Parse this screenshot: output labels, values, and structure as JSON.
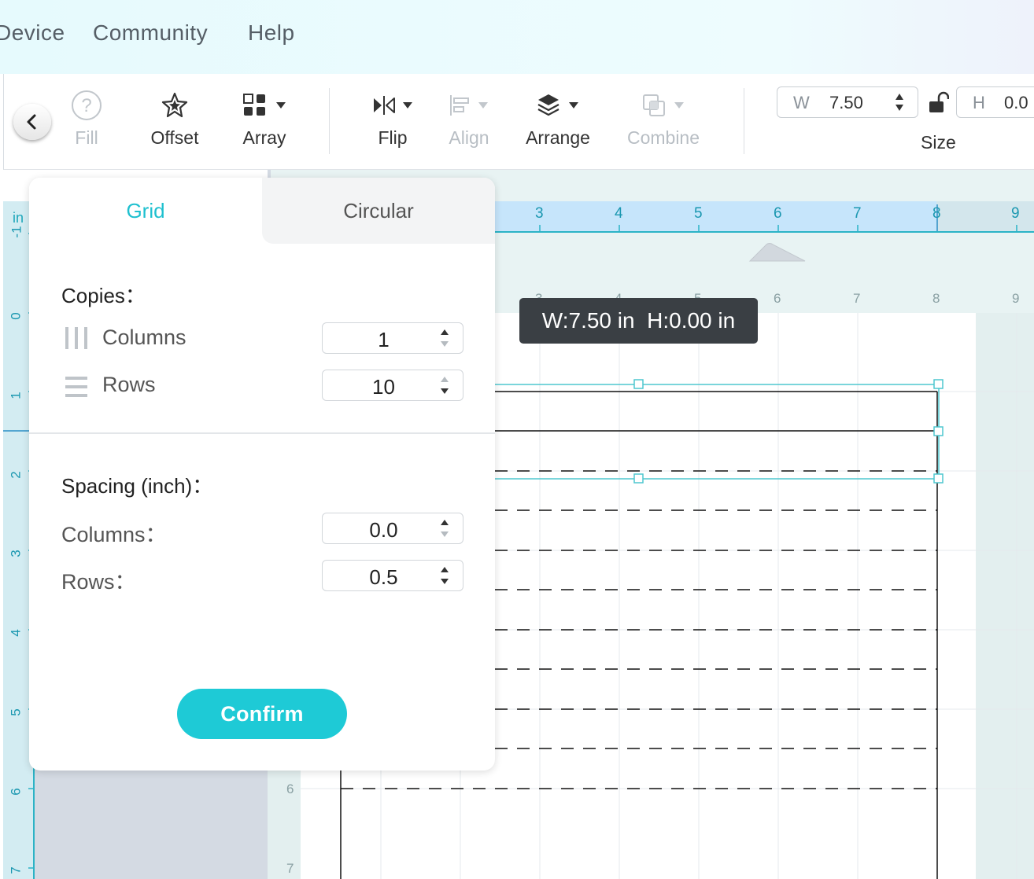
{
  "menu": {
    "items": [
      "Device",
      "Community",
      "Help"
    ]
  },
  "toolbar": {
    "fill_label": "Fill",
    "offset_label": "Offset",
    "array_label": "Array",
    "flip_label": "Flip",
    "align_label": "Align",
    "arrange_label": "Arrange",
    "combine_label": "Combine",
    "size": {
      "w_key": "W",
      "w_value": "7.50",
      "h_key": "H",
      "h_value": "0.0",
      "label": "Size"
    }
  },
  "canvas": {
    "ruler_unit": "in",
    "h_ruler_ticks": [
      "3",
      "4",
      "5",
      "6",
      "7",
      "8",
      "9"
    ],
    "v_ruler_ticks": [
      "-1",
      "0",
      "1",
      "2",
      "3",
      "4",
      "5",
      "6",
      "7"
    ],
    "mat_top_ticks": [
      "3",
      "4",
      "5",
      "6",
      "7",
      "8",
      "9"
    ],
    "mat_left_ticks": [
      "6",
      "7"
    ],
    "tooltip": "W:7.50 in  H:0.00 in"
  },
  "array_popup": {
    "tabs": {
      "grid": "Grid",
      "circular": "Circular"
    },
    "copies_title": "Copies：",
    "columns_label": "Columns",
    "columns_value": "1",
    "rows_label": "Rows",
    "rows_value": "10",
    "spacing_title": "Spacing (inch)：",
    "spacing_columns_label": "Columns：",
    "spacing_columns_value": "0.0",
    "spacing_rows_label": "Rows：",
    "spacing_rows_value": "0.5",
    "confirm_label": "Confirm"
  },
  "colors": {
    "accent": "#1ecad6",
    "ruler": "#c6e5fb",
    "ruler_line": "#2bb3c6",
    "selection": "#4fc7cf"
  }
}
